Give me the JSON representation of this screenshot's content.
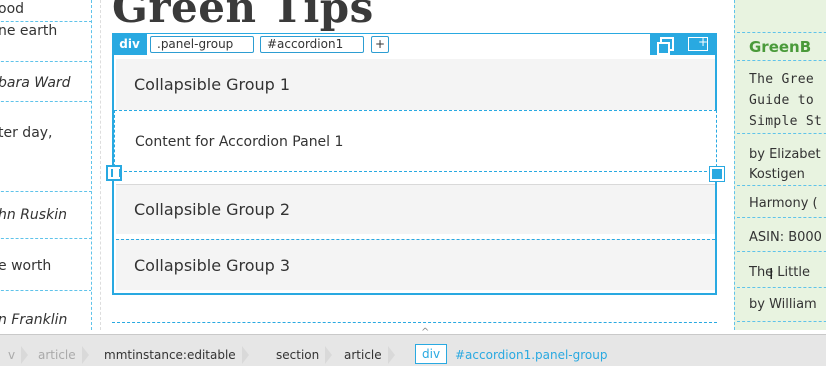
{
  "heading": "Green Tips",
  "left_rows": [
    {
      "text": "ood"
    },
    {
      "text": "ne earth"
    },
    {
      "text": "bara Ward"
    },
    {
      "text": "ter day,"
    },
    {
      "text": "hn Ruskin"
    },
    {
      "text": "e worth"
    },
    {
      "text": "n Franklin"
    }
  ],
  "selection_bar": {
    "tag": "div",
    "class_chip": ".panel-group",
    "id_chip": "#accordion1",
    "add_label": "+"
  },
  "accordion": {
    "group1": "Collapsible Group 1",
    "content1": "Content for Accordion Panel 1",
    "group2": "Collapsible Group 2",
    "group3": "Collapsible Group 3"
  },
  "right_rows": {
    "title": "GreenB",
    "line1": "The Gree",
    "line2": "Guide to",
    "line3": "Simple St",
    "line4": "by Elizabet",
    "line5": "Kostigen",
    "line6": "Harmony (",
    "line7": "ASIN: B000",
    "line8": "The Little",
    "line9": "by William"
  },
  "tag_selector": {
    "items": [
      "v",
      "article",
      "mmtinstance:editable",
      "section",
      "article",
      "div",
      "#accordion1.panel-group"
    ]
  },
  "colors": {
    "accent": "#29a9e1",
    "right_bg": "#e8f3e0",
    "title_green": "#4a9a3a"
  }
}
